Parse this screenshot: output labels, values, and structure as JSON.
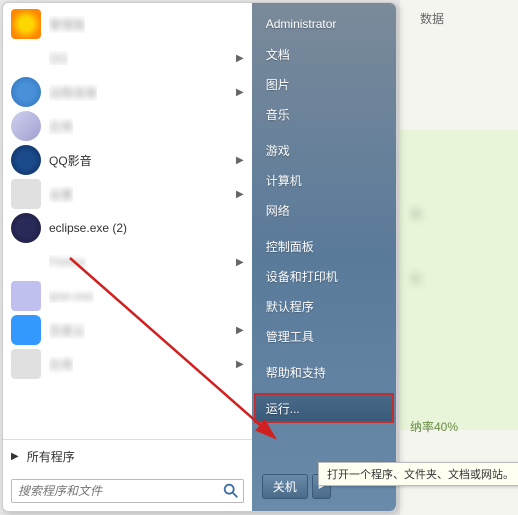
{
  "programs": [
    {
      "label": "管理我",
      "icon": "qq1",
      "blurred": true
    },
    {
      "label": "QQ",
      "icon": "qq2",
      "blurred": true,
      "arrow": true
    },
    {
      "label": "远程连接",
      "icon": "globe",
      "blurred": true,
      "arrow": true
    },
    {
      "label": "应用",
      "icon": "app1",
      "blurred": true
    },
    {
      "label": "QQ影音",
      "icon": "qqplayer",
      "arrow": true
    },
    {
      "label": "设置",
      "icon": "gear",
      "blurred": true,
      "arrow": true
    },
    {
      "label": "eclipse.exe (2)",
      "icon": "eclipse"
    },
    {
      "label": "Firefox",
      "icon": "ff",
      "blurred": true,
      "arrow": true
    },
    {
      "label": "ipse.exe",
      "icon": "app2",
      "blurred": true
    },
    {
      "label": "百度云",
      "icon": "baidu",
      "blurred": true,
      "arrow": true
    },
    {
      "label": "应用",
      "icon": "app3",
      "blurred": true,
      "arrow": true
    }
  ],
  "all_programs_label": "所有程序",
  "search": {
    "placeholder": "搜索程序和文件"
  },
  "right_items_1": [
    "Administrator",
    "文档",
    "图片",
    "音乐"
  ],
  "right_items_2": [
    "游戏",
    "计算机",
    "网络"
  ],
  "right_items_3": [
    "控制面板",
    "设备和打印机",
    "默认程序",
    "管理工具"
  ],
  "right_items_4": [
    "帮助和支持"
  ],
  "run_label": "运行...",
  "shutdown_label": "关机",
  "tooltip_text": "打开一个程序、文件夹、文档或网站。",
  "bg_texts": {
    "top": "数据",
    "rate": "纳率40%"
  }
}
